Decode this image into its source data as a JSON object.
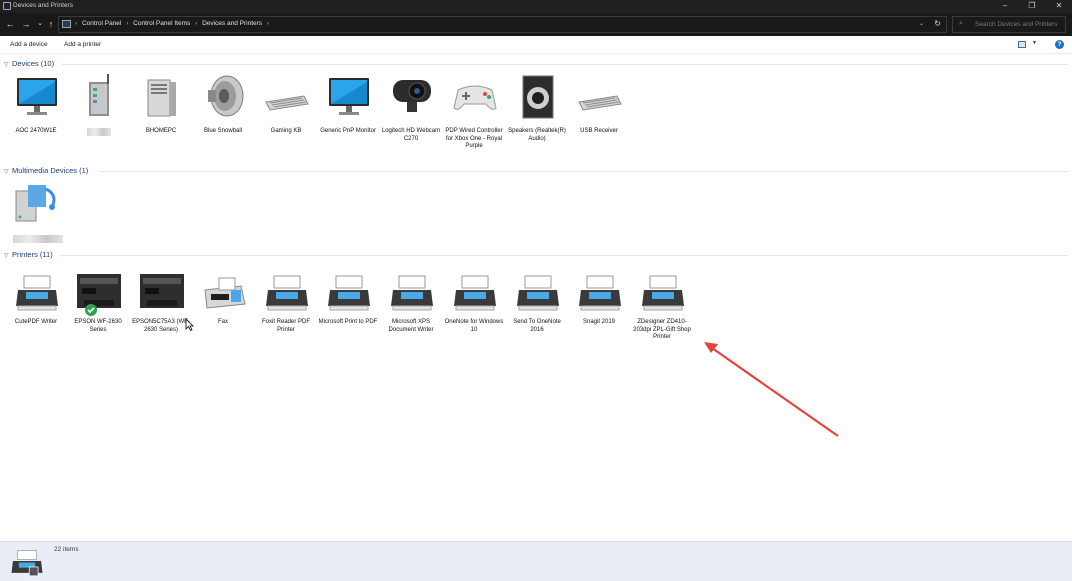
{
  "window": {
    "title": "Devices and Printers",
    "minimize": "–",
    "maximize": "❐",
    "close": "✕"
  },
  "nav": {
    "back": "←",
    "forward": "→",
    "recent": "⌄",
    "up": "↑"
  },
  "address": {
    "crumbs": [
      "Control Panel",
      "Control Panel Items",
      "Devices and Printers"
    ],
    "separator": "›",
    "dropdown": "⌄",
    "refresh": "↻"
  },
  "search": {
    "placeholder": "Search Devices and Printers",
    "icon": "search-icon"
  },
  "commands": {
    "add_device": "Add a device",
    "add_printer": "Add a printer",
    "help": "?"
  },
  "groups": {
    "devices": {
      "title": "Devices (10)"
    },
    "multimedia": {
      "title": "Multimedia Devices (1)"
    },
    "printers": {
      "title": "Printers (11)"
    }
  },
  "devices": [
    {
      "label": "AOC 2470W1E",
      "icon": "monitor-icon"
    },
    {
      "label": "",
      "icon": "router-icon",
      "redacted": true
    },
    {
      "label": "BHOMEPC",
      "icon": "computer-tower-icon"
    },
    {
      "label": "Blue Snowball",
      "icon": "speaker-icon"
    },
    {
      "label": "Gaming KB",
      "icon": "keyboard-icon"
    },
    {
      "label": "Generic PnP Monitor",
      "icon": "monitor-icon"
    },
    {
      "label": "Logitech HD Webcam C270",
      "icon": "webcam-icon"
    },
    {
      "label": "PDP Wired Controller for Xbox One - Royal Purple",
      "icon": "gamepad-icon"
    },
    {
      "label": "Speakers (Realtek(R) Audio)",
      "icon": "speaker-box-icon"
    },
    {
      "label": "USB Receiver",
      "icon": "keyboard-icon"
    }
  ],
  "multimedia": [
    {
      "label": "",
      "icon": "media-device-icon",
      "redacted": true
    }
  ],
  "printers": [
    {
      "label": "CutePDF Writer",
      "icon": "printer-icon"
    },
    {
      "label": "EPSON WF-2630 Series",
      "icon": "multifunction-printer-icon",
      "default": true
    },
    {
      "label": "EPSON5C75A3 (WF-2630 Series)",
      "icon": "multifunction-printer-icon"
    },
    {
      "label": "Fax",
      "icon": "fax-icon"
    },
    {
      "label": "Foxit Reader PDF Printer",
      "icon": "printer-icon"
    },
    {
      "label": "Microsoft Print to PDF",
      "icon": "printer-icon"
    },
    {
      "label": "Microsoft XPS Document Writer",
      "icon": "printer-icon"
    },
    {
      "label": "OneNote for Windows 10",
      "icon": "printer-icon"
    },
    {
      "label": "Send To OneNote 2016",
      "icon": "printer-icon"
    },
    {
      "label": "Snagit 2019",
      "icon": "printer-icon"
    },
    {
      "label": "ZDesigner ZD410-203dpi ZPL-Gift Shop Printer",
      "icon": "printer-icon"
    }
  ],
  "status": {
    "count": "22 items",
    "icon": "printer-icon"
  },
  "annotation": {
    "color": "#e0453a"
  }
}
